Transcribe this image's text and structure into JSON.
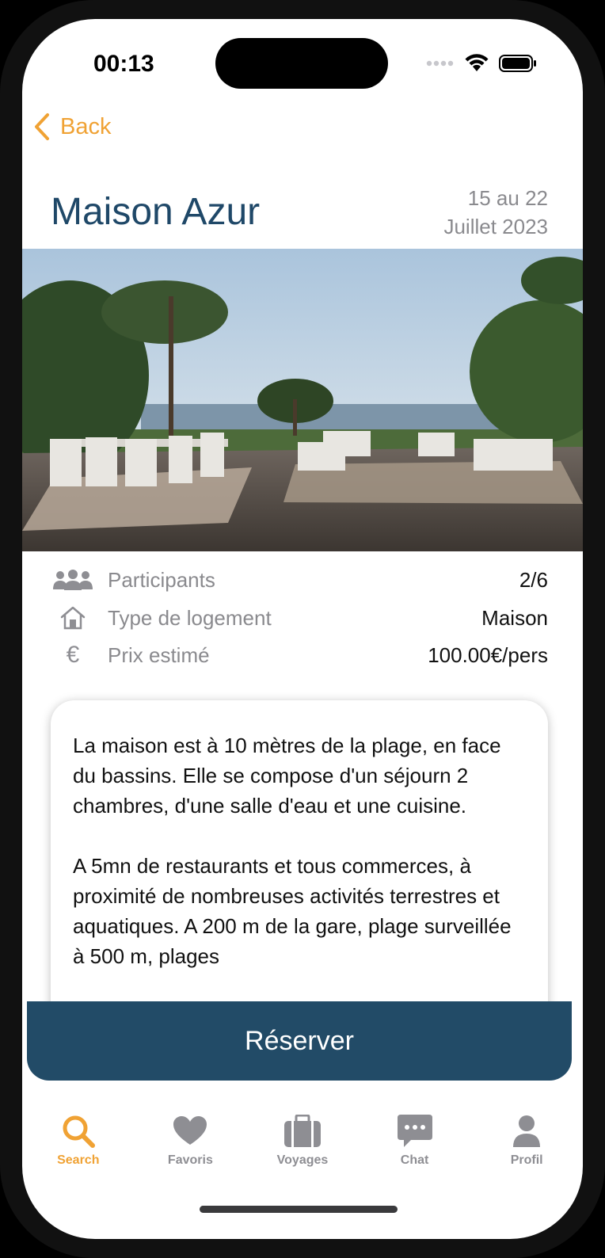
{
  "status_bar": {
    "time": "00:13"
  },
  "nav": {
    "back_label": "Back"
  },
  "listing": {
    "title": "Maison Azur",
    "dates_line1": "15 au 22",
    "dates_line2": "Juillet 2023"
  },
  "details": [
    {
      "icon": "people-icon",
      "label": "Participants",
      "value": "2/6"
    },
    {
      "icon": "house-icon",
      "label": "Type de logement",
      "value": "Maison"
    },
    {
      "icon": "euro-icon",
      "label": "Prix estimé",
      "value": "100.00€/pers"
    }
  ],
  "description": "La maison est à 10 mètres de la plage, en face du bassins. Elle se compose d'un séjourn 2 chambres, d'une salle d'eau et une cuisine.\n\nA 5mn de restaurants et tous commerces, à proximité de nombreuses activités terrestres et aquatiques. A 200 m de la gare, plage surveillée à 500 m, plages",
  "reserve_label": "Réserver",
  "tabs": [
    {
      "icon": "search-icon",
      "label": "Search",
      "active": true
    },
    {
      "icon": "heart-icon",
      "label": "Favoris",
      "active": false
    },
    {
      "icon": "suitcase-icon",
      "label": "Voyages",
      "active": false
    },
    {
      "icon": "chat-icon",
      "label": "Chat",
      "active": false
    },
    {
      "icon": "person-icon",
      "label": "Profil",
      "active": false
    }
  ],
  "colors": {
    "accent": "#f0a234",
    "title": "#1f4868",
    "button": "#224b67",
    "muted": "#8a8a8e"
  }
}
